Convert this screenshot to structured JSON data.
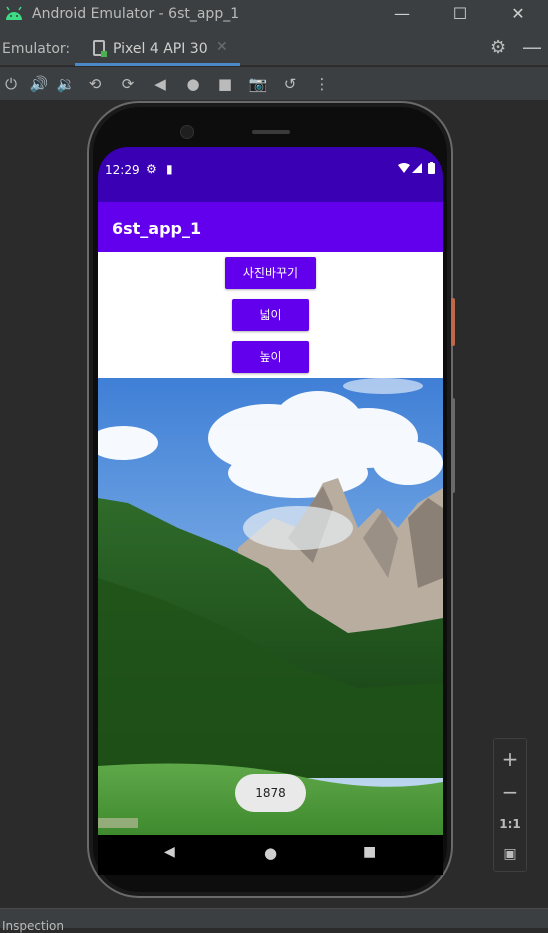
{
  "window": {
    "title": "Android Emulator - 6st_app_1",
    "minimize": "—",
    "maximize": "☐",
    "close": "✕"
  },
  "tabbar": {
    "label": "Emulator:",
    "tab_label": "Pixel 4 API 30",
    "tab_close": "✕",
    "settings_icon": "⚙",
    "hide_icon": "—"
  },
  "toolbar": {
    "icons": [
      "power-icon",
      "volume-up-icon",
      "volume-down-icon",
      "rotate-left-icon",
      "rotate-right-icon",
      "back-icon",
      "home-icon",
      "overview-icon",
      "screenshot-icon",
      "snapshot-icon",
      "more-icon"
    ]
  },
  "status": {
    "time": "12:29"
  },
  "app": {
    "title": "6st_app_1",
    "buttons": {
      "change_photo": "사진바꾸기",
      "width": "넓이",
      "height": "높이"
    },
    "toast": "1878"
  },
  "zoom": {
    "zoom_in": "+",
    "zoom_out": "−",
    "actual_size": "1:1"
  },
  "bottom": {
    "label": "Inspection"
  },
  "colors": {
    "status_bar": "#3a00b3",
    "app_bar": "#6200ee",
    "button": "#6200ee"
  }
}
